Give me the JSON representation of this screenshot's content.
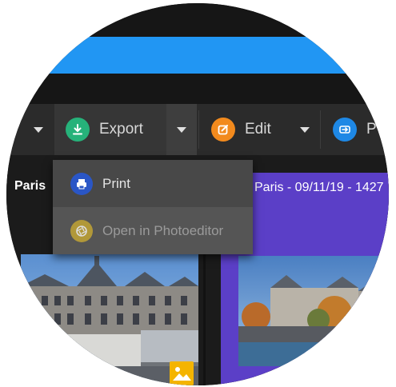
{
  "toolbar": {
    "export_label": "Export",
    "edit_label": "Edit",
    "share_label": "P"
  },
  "export_menu": {
    "items": [
      {
        "label": "Print",
        "enabled": true
      },
      {
        "label": "Open in Photoeditor",
        "enabled": false
      }
    ]
  },
  "gallery": {
    "left_title": "Paris",
    "right_title": "Paris - 09/11/19 - 1427"
  },
  "colors": {
    "accent_blue": "#2196f3",
    "export_icon": "#26b27a",
    "edit_icon": "#f28a1d",
    "share_icon": "#1e88e5",
    "print_icon": "#2a56c6",
    "photoeditor_icon": "#c9a933",
    "album_bg": "#5b3fc7"
  },
  "icons": {
    "export": "download-icon",
    "edit": "edit-square-icon",
    "share": "share-arrow-icon",
    "print": "printer-icon",
    "photoeditor": "aperture-icon",
    "image_badge": "image-icon"
  }
}
